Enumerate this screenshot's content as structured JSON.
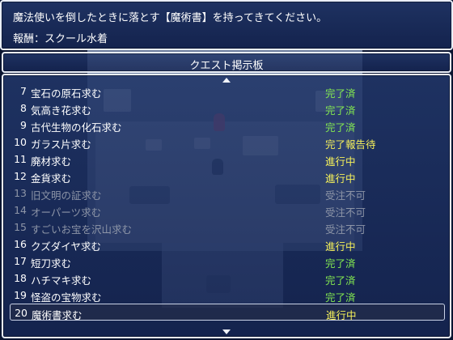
{
  "help": {
    "line1": "魔法使いを倒したときに落とす【魔術書】を持ってきてください。",
    "line2": "報酬：スクール水着"
  },
  "title": "クエスト掲示板",
  "quests": [
    {
      "num": "7",
      "name": "宝石の原石求む",
      "status": "完了済",
      "state": "done"
    },
    {
      "num": "8",
      "name": "気高き花求む",
      "status": "完了済",
      "state": "done"
    },
    {
      "num": "9",
      "name": "古代生物の化石求む",
      "status": "完了済",
      "state": "done"
    },
    {
      "num": "10",
      "name": "ガラス片求む",
      "status": "完了報告待",
      "state": "report"
    },
    {
      "num": "11",
      "name": "廃材求む",
      "status": "進行中",
      "state": "progress"
    },
    {
      "num": "12",
      "name": "金貨求む",
      "status": "進行中",
      "state": "progress"
    },
    {
      "num": "13",
      "name": "旧文明の証求む",
      "status": "受注不可",
      "state": "locked"
    },
    {
      "num": "14",
      "name": "オーパーツ求む",
      "status": "受注不可",
      "state": "locked"
    },
    {
      "num": "15",
      "name": "すごいお宝を沢山求む",
      "status": "受注不可",
      "state": "locked"
    },
    {
      "num": "16",
      "name": "クズダイヤ求む",
      "status": "進行中",
      "state": "progress"
    },
    {
      "num": "17",
      "name": "短刀求む",
      "status": "完了済",
      "state": "done"
    },
    {
      "num": "18",
      "name": "ハチマキ求む",
      "status": "完了済",
      "state": "done"
    },
    {
      "num": "19",
      "name": "怪盗の宝物求む",
      "status": "完了済",
      "state": "done"
    },
    {
      "num": "20",
      "name": "魔術書求む",
      "status": "進行中",
      "state": "progress"
    }
  ],
  "selected_index": 13,
  "colors": {
    "done": "#84ea50",
    "in_progress": "#f6f15a",
    "disabled": "#8d95a7",
    "window_bg": "#22386c",
    "window_border": "#e9eef8"
  },
  "icons": {
    "scroll_up": "triangle-up",
    "scroll_down": "triangle-down"
  }
}
